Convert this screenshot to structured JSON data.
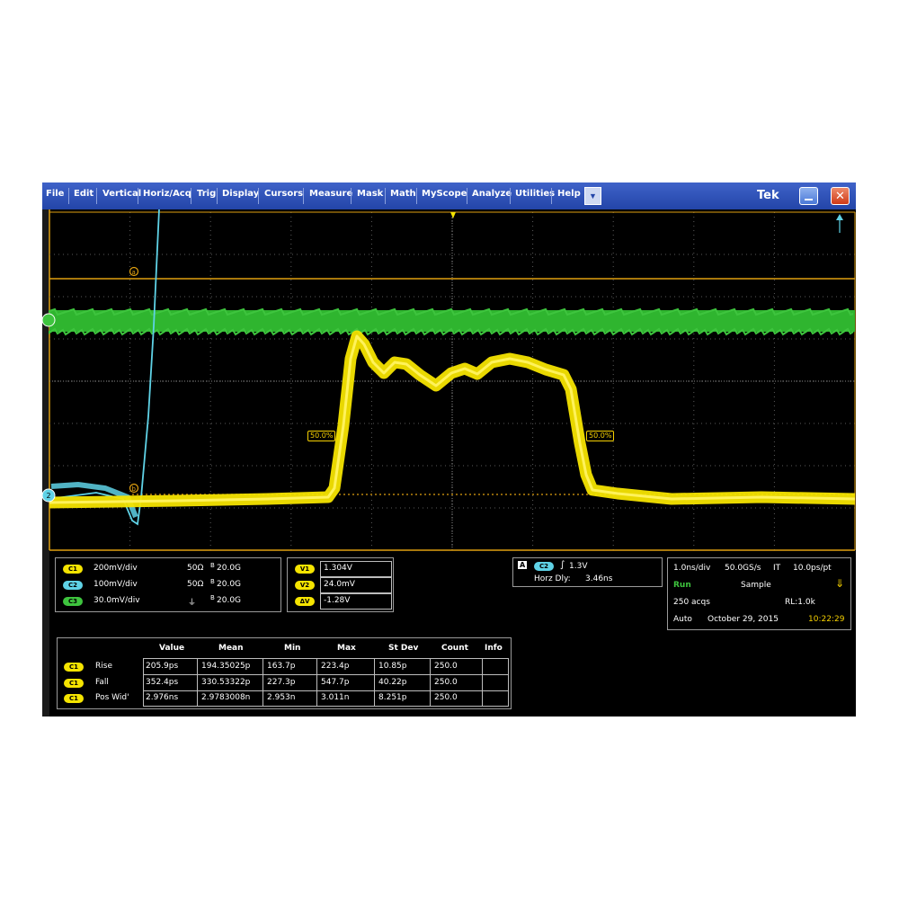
{
  "menu": {
    "items": [
      "File",
      "Edit",
      "Vertical",
      "Horiz/Acq",
      "Trig",
      "Display",
      "Cursors",
      "Measure",
      "Mask",
      "Math",
      "MyScope",
      "Analyze",
      "Utilities",
      "Help"
    ],
    "brand": "Tek",
    "close_glyph": "✕",
    "dropdown_glyph": "▼"
  },
  "markers": {
    "ref_a": "a",
    "ref_b": "b",
    "ch1_level": "1",
    "ch2_level": "2",
    "left_pct": "50.0%",
    "right_pct": "50.0%"
  },
  "channels": [
    {
      "chip": "C1",
      "scale": "200mV/div",
      "imp": "50Ω",
      "bw": "20.0G",
      "color": "#f5e400"
    },
    {
      "chip": "C2",
      "scale": "100mV/div",
      "imp": "50Ω",
      "bw": "20.0G",
      "color": "#5fd2e6"
    },
    {
      "chip": "C3",
      "scale": "30.0mV/div",
      "imp": "⏚",
      "bw": "20.0G",
      "color": "#3ec43e"
    }
  ],
  "cursors": [
    {
      "chip": "V1",
      "value": "1.304V"
    },
    {
      "chip": "V2",
      "value": "24.0mV"
    },
    {
      "chip": "ΔV",
      "value": "-1.28V"
    }
  ],
  "trigger": {
    "mode": "A",
    "chip": "C2",
    "slope_glyph": "∫",
    "level": "1.3V",
    "horz_label": "Horz Dly:",
    "horz_value": "3.46ns"
  },
  "acq": {
    "timebase": "1.0ns/div",
    "rate": "50.0GS/s",
    "mode_it": "IT",
    "res": "10.0ps/pt",
    "run": "Run",
    "sample": "Sample",
    "acqs": "250 acqs",
    "rl": "RL:1.0k",
    "trigmode": "Auto",
    "date": "October 29, 2015",
    "time": "10:22:29"
  },
  "measurements": {
    "headers": [
      "Value",
      "Mean",
      "Min",
      "Max",
      "St Dev",
      "Count",
      "Info"
    ],
    "rows": [
      {
        "chip": "C1",
        "name": "Rise",
        "cells": [
          "205.9ps",
          "194.35025p",
          "163.7p",
          "223.4p",
          "10.85p",
          "250.0",
          ""
        ]
      },
      {
        "chip": "C1",
        "name": "Fall",
        "cells": [
          "352.4ps",
          "330.53322p",
          "227.3p",
          "547.7p",
          "40.22p",
          "250.0",
          ""
        ]
      },
      {
        "chip": "C1",
        "name": "Pos Wid'",
        "cells": [
          "2.976ns",
          "2.9783008n",
          "2.953n",
          "3.011n",
          "8.251p",
          "250.0",
          ""
        ]
      }
    ]
  },
  "colors": {
    "ch1": "#f5e400",
    "ch2": "#5fd2e6",
    "ch3": "#3ec43e",
    "menubar": "#2d52b8",
    "orange": "#e0a010"
  }
}
